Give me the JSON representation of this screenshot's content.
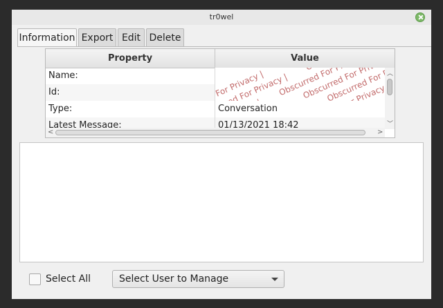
{
  "window": {
    "title": "tr0wel"
  },
  "tabs": [
    {
      "label": "Information",
      "active": true
    },
    {
      "label": "Export",
      "active": false
    },
    {
      "label": "Edit",
      "active": false
    },
    {
      "label": "Delete",
      "active": false
    }
  ],
  "properties_table": {
    "columns": [
      "Property",
      "Value"
    ],
    "rows": [
      {
        "property": "Name:",
        "value": ""
      },
      {
        "property": "Id:",
        "value": ""
      },
      {
        "property": "Type:",
        "value": "Conversation"
      },
      {
        "property": "Latest Message:",
        "value": "01/13/2021 18:42"
      }
    ],
    "redaction_watermark": "Obscurred For Privacy |"
  },
  "footer": {
    "select_all_label": "Select All",
    "select_all_checked": false,
    "user_select": {
      "selected": "Select User to Manage"
    }
  },
  "colors": {
    "close_button": "#7cb867",
    "redaction_text": "#c26b6b"
  }
}
